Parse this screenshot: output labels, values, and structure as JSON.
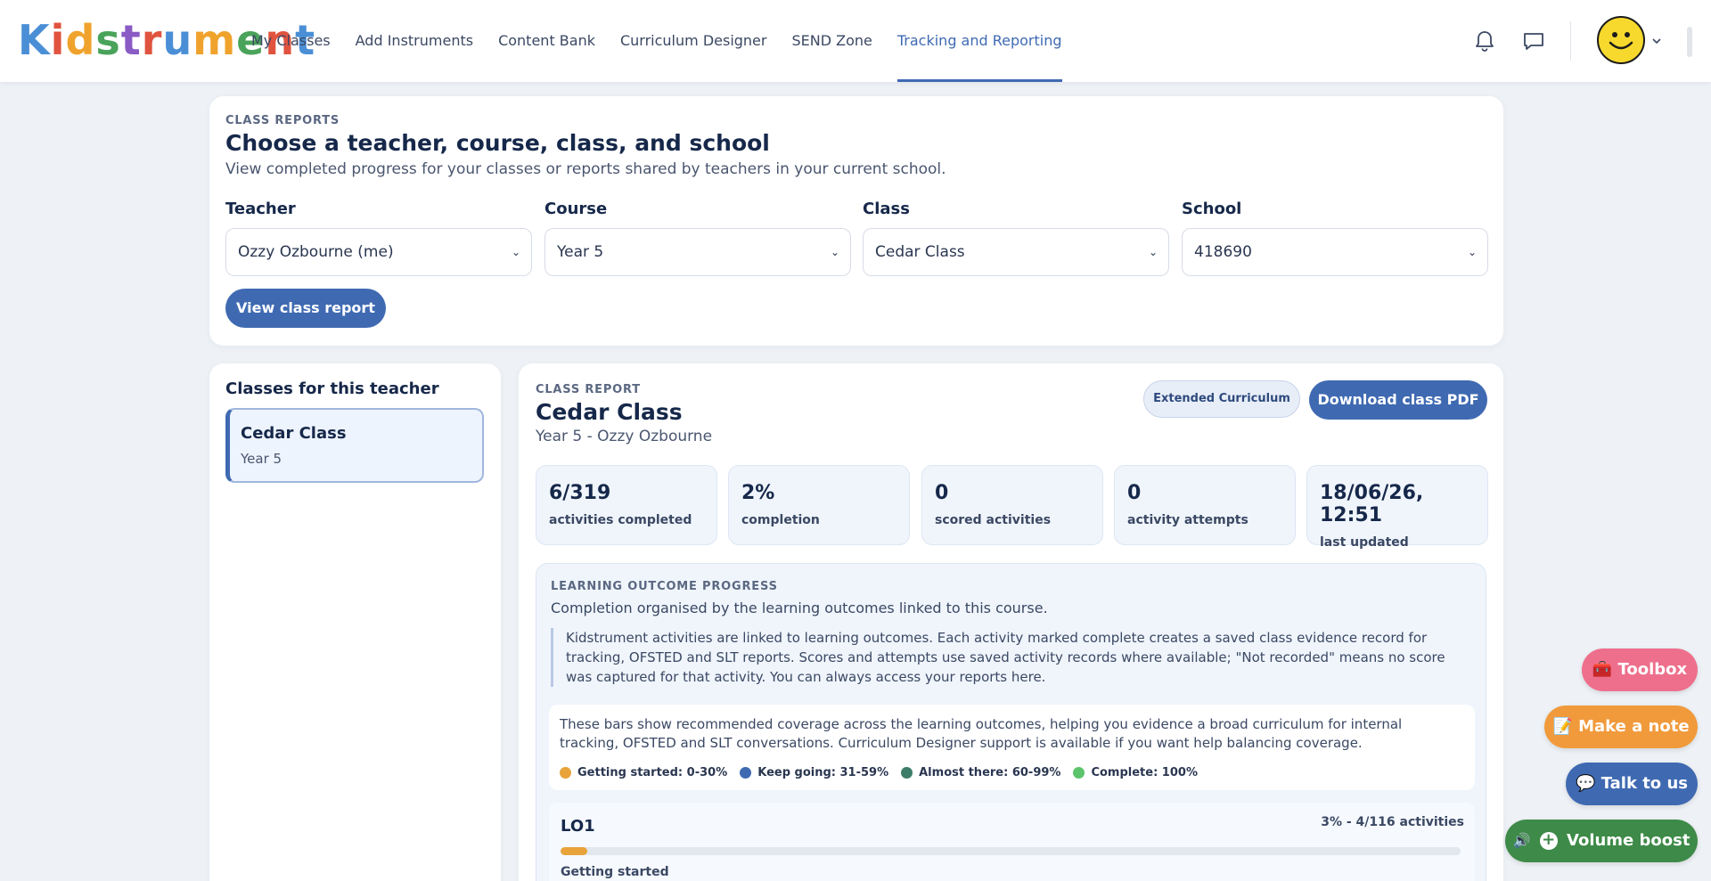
{
  "brand": {
    "name": "Kidstrument",
    "letters": [
      "K",
      "i",
      "d",
      "s",
      "t",
      "r",
      "u",
      "m",
      "e",
      "n",
      "t"
    ]
  },
  "nav": {
    "items": [
      {
        "label": "My Classes"
      },
      {
        "label": "Add Instruments"
      },
      {
        "label": "Content Bank"
      },
      {
        "label": "Curriculum Designer"
      },
      {
        "label": "SEND Zone"
      },
      {
        "label": "Tracking and Reporting",
        "active": true
      }
    ],
    "icons": [
      "bell-icon",
      "chat-icon",
      "avatar-smiley",
      "chevron-down-icon"
    ]
  },
  "filters": {
    "eyebrow": "CLASS REPORTS",
    "title": "Choose a teacher, course, class, and school",
    "subtitle": "View completed progress for your classes or reports shared by teachers in your current school.",
    "teacher": {
      "label": "Teacher",
      "value": "Ozzy Ozbourne (me)"
    },
    "course": {
      "label": "Course",
      "value": "Year 5"
    },
    "class": {
      "label": "Class",
      "value": "Cedar Class"
    },
    "school": {
      "label": "School",
      "value": "418690"
    },
    "button": "View class report"
  },
  "teacher_classes": {
    "heading": "Classes for this teacher",
    "items": [
      {
        "name": "Cedar Class",
        "course": "Year 5"
      }
    ]
  },
  "report": {
    "eyebrow": "CLASS REPORT",
    "title": "Cedar Class",
    "subtitle": "Year 5 - Ozzy Ozbourne",
    "badge": "Extended Curriculum",
    "download": "Download class PDF",
    "stats": [
      {
        "value": "6/319",
        "label": "activities completed"
      },
      {
        "value": "2%",
        "label": "completion"
      },
      {
        "value": "0",
        "label": "scored activities"
      },
      {
        "value": "0",
        "label": "activity attempts"
      },
      {
        "value": "18/06/26, 12:51",
        "label": "last updated"
      }
    ],
    "outcomes": {
      "eyebrow": "LEARNING OUTCOME PROGRESS",
      "subtitle": "Completion organised by the learning outcomes linked to this course.",
      "note": "Kidstrument activities are linked to learning outcomes. Each activity marked complete creates a saved class evidence record for tracking, OFSTED and SLT reports. Scores and attempts use saved activity records where available; \"Not recorded\" means no score was captured for that activity. You can always access your reports here.",
      "coverage": "These bars show recommended coverage across the learning outcomes, helping you evidence a broad curriculum for internal tracking, OFSTED and SLT conversations. Curriculum Designer support is available if you want help balancing coverage.",
      "legend": [
        {
          "label": "Getting started: 0-30%",
          "color": "#e8a33a"
        },
        {
          "label": "Keep going: 31-59%",
          "color": "#3f6ab2"
        },
        {
          "label": "Almost there: 60-99%",
          "color": "#3c7d6a"
        },
        {
          "label": "Complete: 100%",
          "color": "#5cc46a"
        }
      ],
      "rows": [
        {
          "code": "LO1",
          "summary": "3% - 4/116 activities",
          "progress": 0.03,
          "status": "Getting started"
        }
      ]
    }
  },
  "fabs": {
    "toolbox": "🧰 Toolbox",
    "note": "📝 Make a note",
    "talk": "💬 Talk to us",
    "volume": "Volume boost"
  }
}
